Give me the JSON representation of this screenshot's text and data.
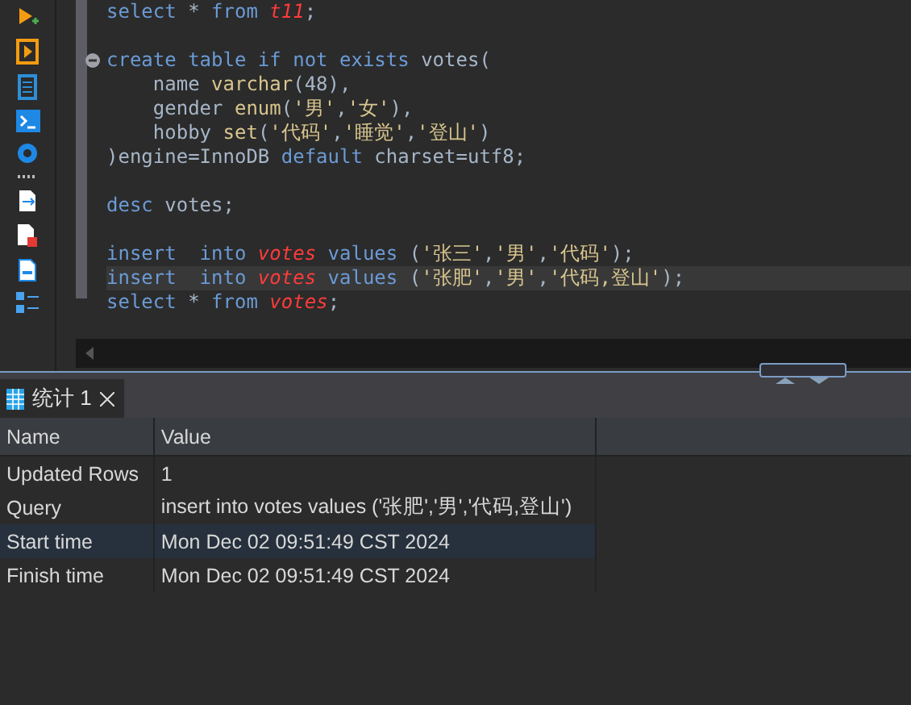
{
  "editor": {
    "lines": [
      {
        "kind": "code",
        "fold": false,
        "current": false,
        "tokens": [
          {
            "kind": "keyword",
            "text": "select"
          },
          {
            "kind": "plain",
            "text": " * "
          },
          {
            "kind": "keyword",
            "text": "from"
          },
          {
            "kind": "table",
            "text": " t11"
          },
          {
            "kind": "plain",
            "text": ";"
          }
        ]
      },
      {
        "kind": "blank"
      },
      {
        "kind": "code",
        "fold": true,
        "current": false,
        "tokens": [
          {
            "kind": "keyword",
            "text": "create table if not exists"
          },
          {
            "kind": "plain",
            "text": " votes("
          }
        ]
      },
      {
        "kind": "code",
        "fold": false,
        "current": false,
        "tokens": [
          {
            "kind": "plain",
            "text": "    name "
          },
          {
            "kind": "function",
            "text": "varchar"
          },
          {
            "kind": "plain",
            "text": "(48),"
          }
        ]
      },
      {
        "kind": "code",
        "fold": false,
        "current": false,
        "tokens": [
          {
            "kind": "plain",
            "text": "    gender "
          },
          {
            "kind": "function",
            "text": "enum"
          },
          {
            "kind": "plain",
            "text": "("
          },
          {
            "kind": "string",
            "text": "'男'"
          },
          {
            "kind": "plain",
            "text": ","
          },
          {
            "kind": "string",
            "text": "'女'"
          },
          {
            "kind": "plain",
            "text": "),"
          }
        ]
      },
      {
        "kind": "code",
        "fold": false,
        "current": false,
        "tokens": [
          {
            "kind": "plain",
            "text": "    hobby "
          },
          {
            "kind": "function",
            "text": "set"
          },
          {
            "kind": "plain",
            "text": "("
          },
          {
            "kind": "string",
            "text": "'代码'"
          },
          {
            "kind": "plain",
            "text": ","
          },
          {
            "kind": "string",
            "text": "'睡觉'"
          },
          {
            "kind": "plain",
            "text": ","
          },
          {
            "kind": "string",
            "text": "'登山'"
          },
          {
            "kind": "plain",
            "text": ")"
          }
        ]
      },
      {
        "kind": "code",
        "fold": false,
        "current": false,
        "tokens": [
          {
            "kind": "plain",
            "text": ")engine=InnoDB "
          },
          {
            "kind": "keyword",
            "text": "default"
          },
          {
            "kind": "plain",
            "text": " charset=utf8;"
          }
        ]
      },
      {
        "kind": "blank"
      },
      {
        "kind": "code",
        "fold": false,
        "current": false,
        "tokens": [
          {
            "kind": "keyword",
            "text": "desc"
          },
          {
            "kind": "plain",
            "text": " votes;"
          }
        ]
      },
      {
        "kind": "blank"
      },
      {
        "kind": "code",
        "fold": false,
        "current": false,
        "tokens": [
          {
            "kind": "keyword",
            "text": "insert  into"
          },
          {
            "kind": "table",
            "text": " votes"
          },
          {
            "kind": "keyword",
            "text": " values"
          },
          {
            "kind": "plain",
            "text": " ("
          },
          {
            "kind": "string",
            "text": "'张三'"
          },
          {
            "kind": "plain",
            "text": ","
          },
          {
            "kind": "string",
            "text": "'男'"
          },
          {
            "kind": "plain",
            "text": ","
          },
          {
            "kind": "string",
            "text": "'代码'"
          },
          {
            "kind": "plain",
            "text": ");"
          }
        ]
      },
      {
        "kind": "code",
        "fold": false,
        "current": true,
        "tokens": [
          {
            "kind": "keyword",
            "text": "insert  into"
          },
          {
            "kind": "table",
            "text": " votes"
          },
          {
            "kind": "keyword",
            "text": " values"
          },
          {
            "kind": "plain",
            "text": " ("
          },
          {
            "kind": "string",
            "text": "'张肥'"
          },
          {
            "kind": "plain",
            "text": ","
          },
          {
            "kind": "string",
            "text": "'男'"
          },
          {
            "kind": "plain",
            "text": ","
          },
          {
            "kind": "string",
            "text": "'代码,登山'"
          },
          {
            "kind": "plain",
            "text": ");"
          }
        ]
      },
      {
        "kind": "code",
        "fold": false,
        "current": false,
        "tokens": [
          {
            "kind": "keyword",
            "text": "select"
          },
          {
            "kind": "plain",
            "text": " * "
          },
          {
            "kind": "keyword",
            "text": "from"
          },
          {
            "kind": "table",
            "text": " votes"
          },
          {
            "kind": "plain",
            "text": ";"
          }
        ]
      }
    ]
  },
  "tabs": [
    {
      "label": "统计 1",
      "selected": true
    }
  ],
  "table": {
    "columns": [
      "Name",
      "Value"
    ],
    "rows": [
      {
        "cells": [
          "Updated Rows",
          "1"
        ],
        "selected": false
      },
      {
        "cells": [
          "Query",
          "insert  into votes values ('张肥','男','代码,登山')"
        ],
        "selected": false
      },
      {
        "cells": [
          "Start time",
          "Mon Dec 02 09:51:49 CST 2024"
        ],
        "selected": true
      },
      {
        "cells": [
          "Finish time",
          "Mon Dec 02 09:51:49 CST 2024"
        ],
        "selected": false
      }
    ]
  }
}
